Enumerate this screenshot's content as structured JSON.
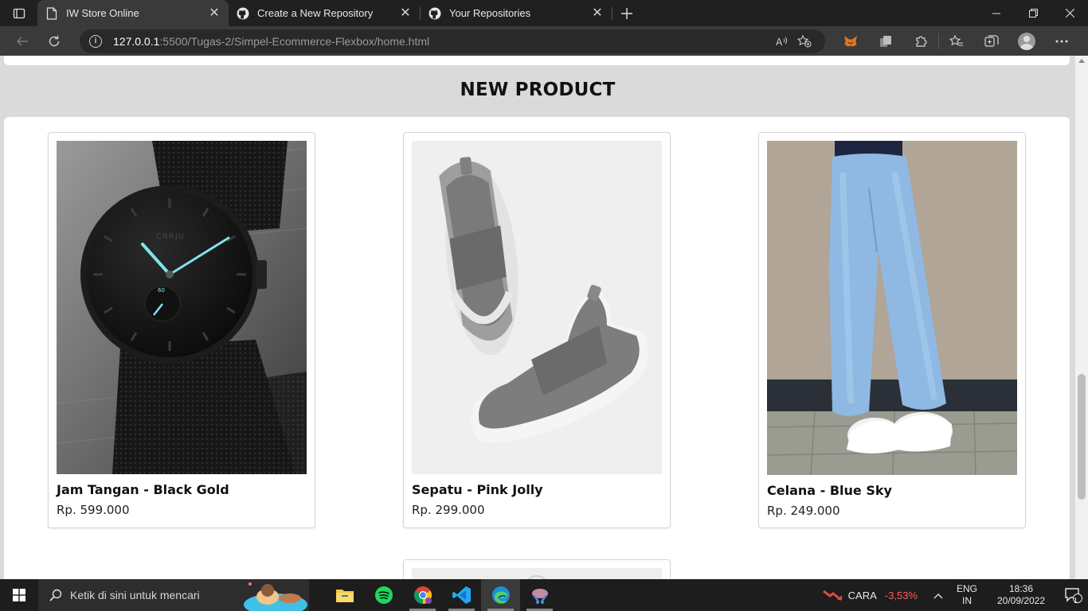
{
  "browser": {
    "tabs": [
      {
        "title": "IW Store Online",
        "icon": "page-icon",
        "active": true
      },
      {
        "title": "Create a New Repository",
        "icon": "github-icon",
        "active": false
      },
      {
        "title": "Your Repositories",
        "icon": "github-icon",
        "active": false
      }
    ],
    "url_host": "127.0.0.1",
    "url_rest": ":5500/Tugas-2/Simpel-Ecommerce-Flexbox/home.html"
  },
  "page": {
    "section_title": "NEW PRODUCT",
    "products": [
      {
        "name": "Jam Tangan - Black Gold",
        "price": "Rp. 599.000",
        "image": "black mesh wristwatch"
      },
      {
        "name": "Sepatu - Pink Jolly",
        "price": "Rp. 299.000",
        "image": "grey slip-on sneakers"
      },
      {
        "name": "Celana - Blue Sky",
        "price": "Rp. 249.000",
        "image": "light blue jeans with white sneakers"
      }
    ]
  },
  "taskbar": {
    "search_placeholder": "Ketik di sini untuk mencari",
    "stock_name": "CARA",
    "stock_change": "-3,53%",
    "lang_top": "ENG",
    "lang_bottom": "IN",
    "time": "18:36",
    "date": "20/09/2022",
    "notification_count": "1"
  },
  "colors": {
    "accent_cyan": "#7fe3f0",
    "stock_negative": "#ff5a5a",
    "vscode_blue": "#23a9f2",
    "spotify_green": "#1ed760"
  }
}
